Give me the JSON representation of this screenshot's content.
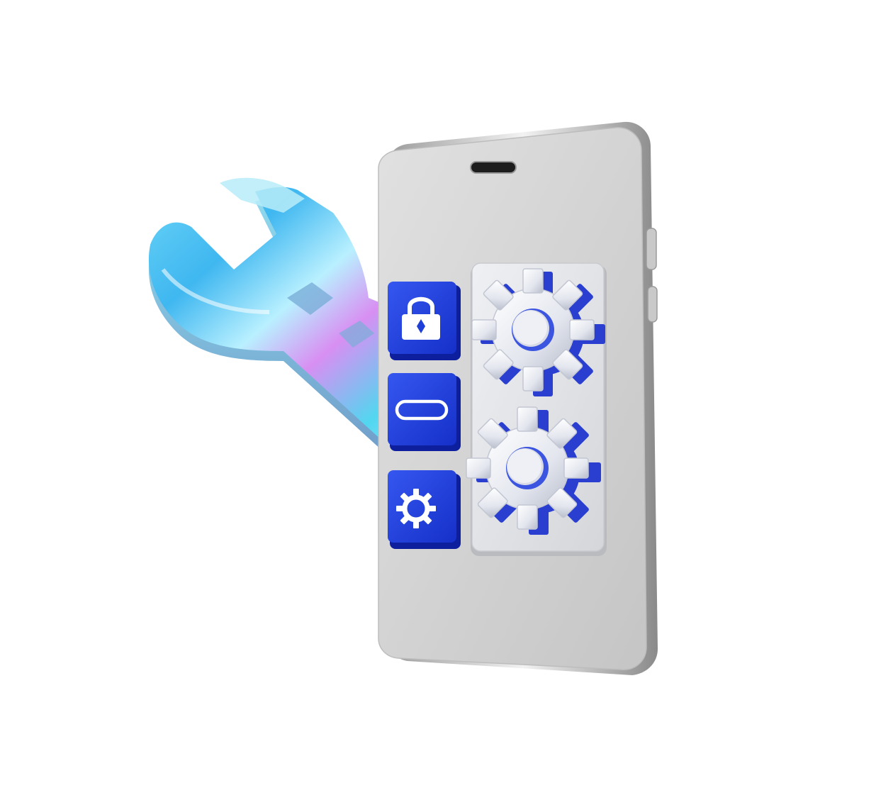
{
  "illustration": {
    "icons": [
      "wrench-icon",
      "smartphone-icon",
      "speaker-slot-icon",
      "side-button-icon",
      "lock-icon",
      "toggle-icon",
      "gear-icon",
      "large-gear-icon"
    ],
    "colors": {
      "background": "#ffffff",
      "phone_body": "#d2d2d2",
      "phone_edge": "#a9a9a9",
      "tile_blue": "#1e3fd8",
      "tile_blue_dark": "#0e1f9e",
      "gear_silver": "#e6e8ee",
      "wrench_cyan": "#4fd3f5",
      "wrench_magenta": "#d88ff2"
    }
  }
}
